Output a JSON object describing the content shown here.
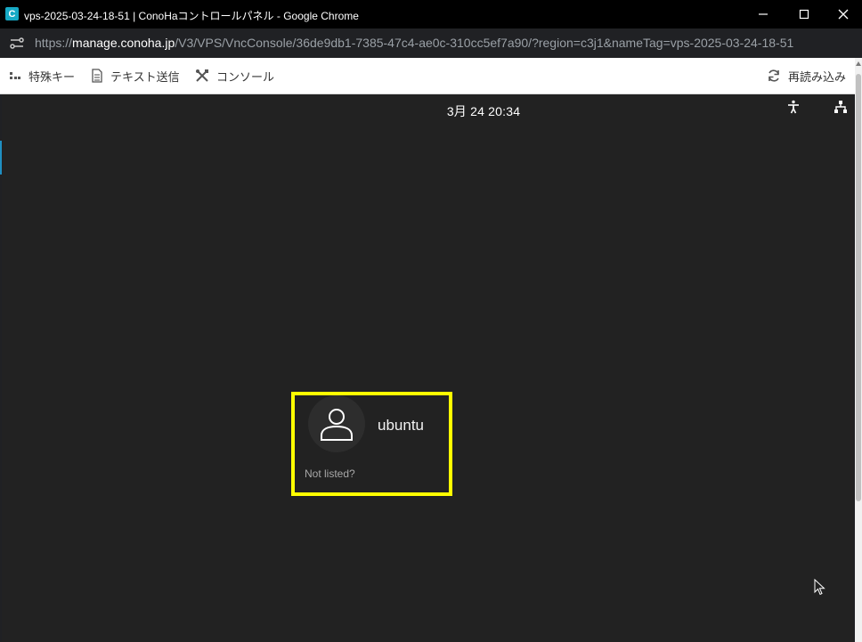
{
  "window": {
    "title": "vps-2025-03-24-18-51 | ConoHaコントロールパネル - Google Chrome",
    "app_icon_letter": "C"
  },
  "address_bar": {
    "scheme": "https://",
    "host": "manage.conoha.jp",
    "path": "/V3/VPS/VncConsole/36de9db1-7385-47c4-ae0c-310cc5ef7a90/?region=c3j1&nameTag=vps-2025-03-24-18-51"
  },
  "toolbar": {
    "special_keys": "特殊キー",
    "send_text": "テキスト送信",
    "console": "コンソール",
    "reload": "再読み込み"
  },
  "vnc": {
    "clock": "3月 24  20:34",
    "user": {
      "name": "ubuntu"
    },
    "not_listed": "Not listed?"
  },
  "colors": {
    "highlight": "#ffff00",
    "desktop_bg": "#222222",
    "accent": "#1f8fc2"
  },
  "icons": [
    "app-icon",
    "minimize-icon",
    "maximize-icon",
    "close-icon",
    "site-info-icon",
    "special-keys-icon",
    "document-icon",
    "tools-icon",
    "refresh-icon",
    "accessibility-icon",
    "network-icon",
    "user-icon",
    "mouse-cursor-icon"
  ]
}
